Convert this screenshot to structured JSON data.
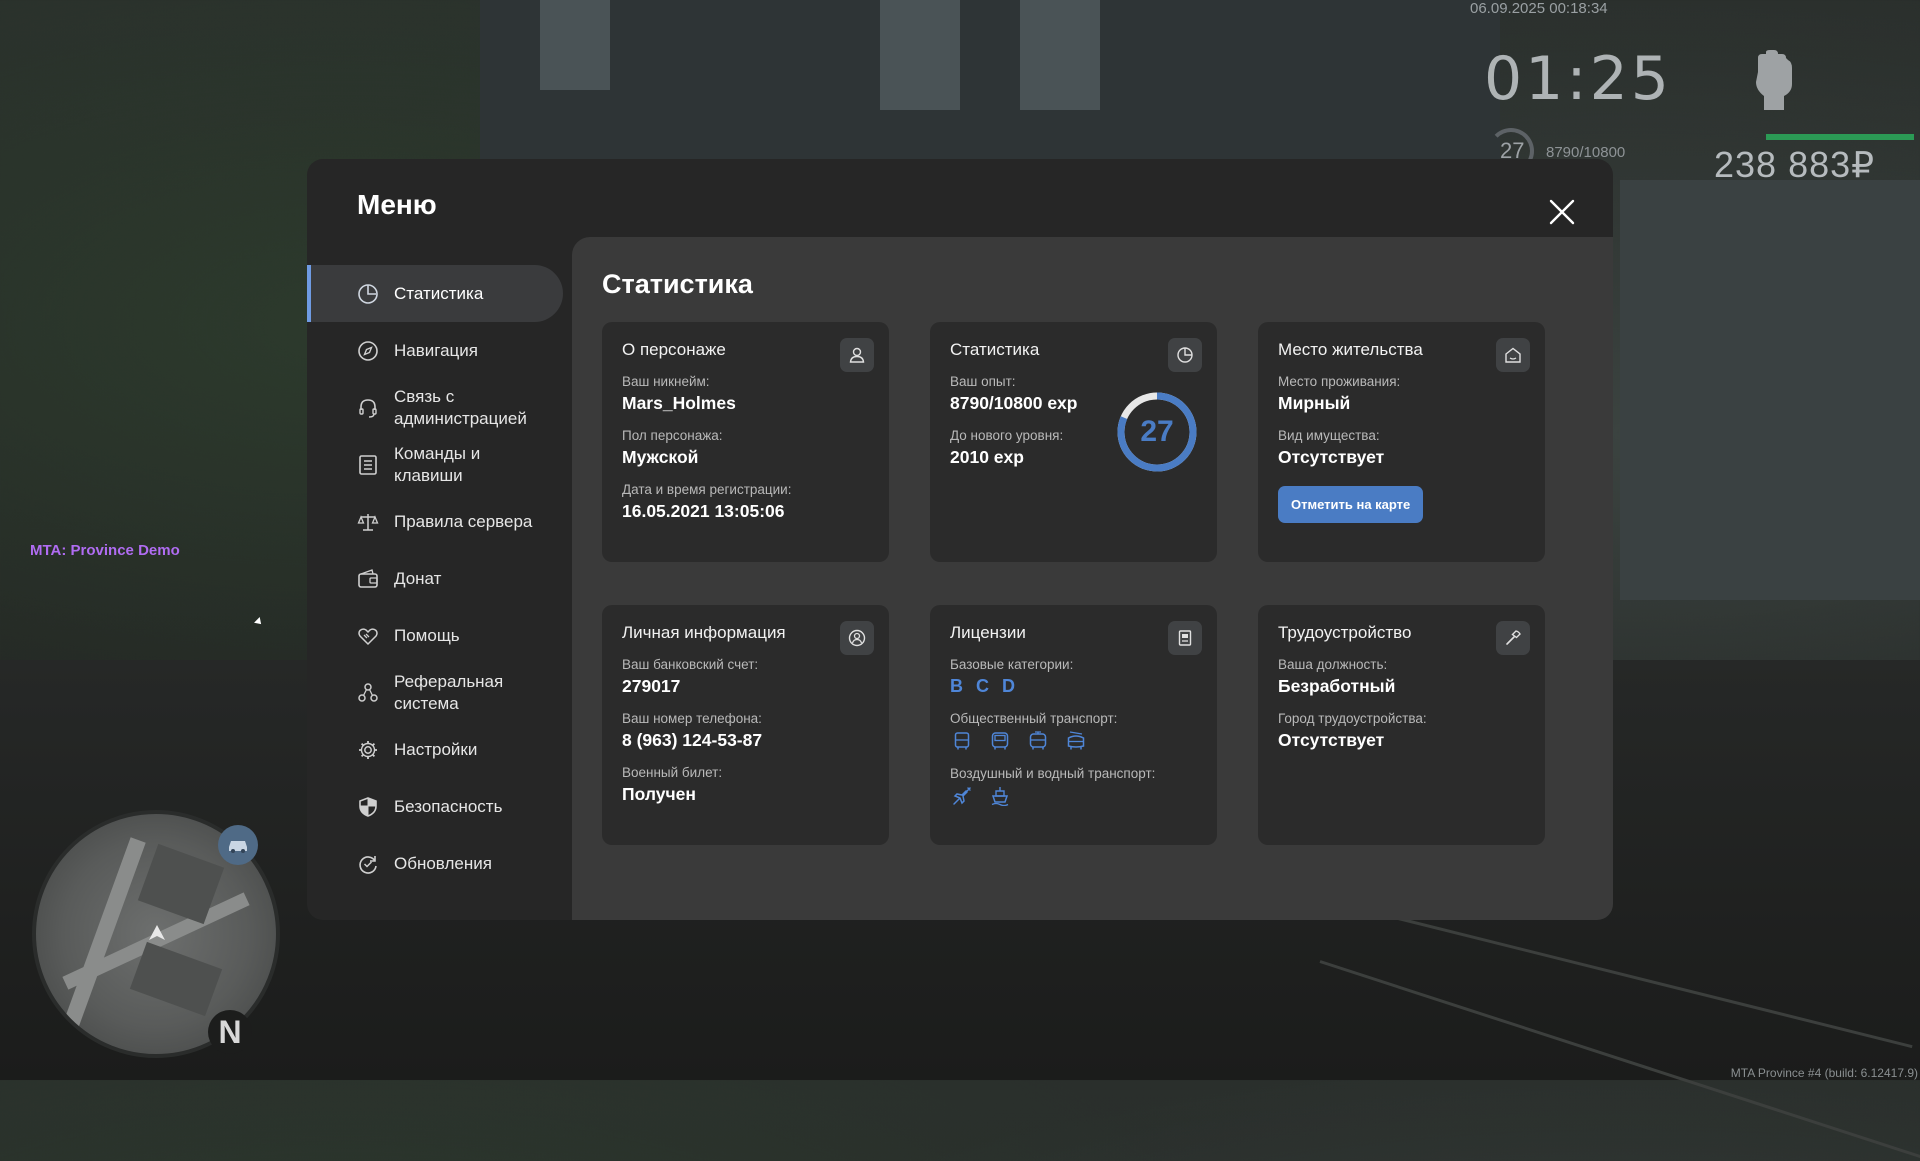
{
  "hud": {
    "datetime": "06.09.2025 00:18:34",
    "clock": "01:25",
    "level": "27",
    "exp": "8790/10800",
    "money": "238 883₽",
    "health_fraction": 1.0
  },
  "server_label": "MTA: Province Demo",
  "build_info": "MTA Province #4 (build: 6.12417.9)",
  "minimap": {
    "north_label": "N"
  },
  "menu": {
    "title": "Меню",
    "sidebar": [
      {
        "label": "Статистика",
        "icon": "pie-chart-icon",
        "active": true
      },
      {
        "label": "Навигация",
        "icon": "compass-icon"
      },
      {
        "label": "Связь с администрацией",
        "icon": "headset-icon"
      },
      {
        "label": "Команды и клавиши",
        "icon": "list-icon"
      },
      {
        "label": "Правила сервера",
        "icon": "scales-icon"
      },
      {
        "label": "Донат",
        "icon": "wallet-icon"
      },
      {
        "label": "Помощь",
        "icon": "handshake-icon"
      },
      {
        "label": "Реферальная система",
        "icon": "referral-icon"
      },
      {
        "label": "Настройки",
        "icon": "gear-icon"
      },
      {
        "label": "Безопасность",
        "icon": "shield-icon"
      },
      {
        "label": "Обновления",
        "icon": "refresh-icon"
      }
    ],
    "content_title": "Статистика",
    "cards": {
      "character": {
        "title": "О персонаже",
        "icon": "user-icon",
        "nickname_label": "Ваш никнейм:",
        "nickname": "Mars_Holmes",
        "gender_label": "Пол персонажа:",
        "gender": "Мужской",
        "reg_label": "Дата и время регистрации:",
        "reg": "16.05.2021 13:05:06"
      },
      "stats": {
        "title": "Статистика",
        "icon": "pie-chart-icon",
        "exp_label": "Ваш опыт:",
        "exp": "8790/10800 exp",
        "next_label": "До нового уровня:",
        "next": "2010 exp",
        "level": "27",
        "progress_fraction": 0.814
      },
      "residence": {
        "title": "Место жительства",
        "icon": "house-icon",
        "place_label": "Место проживания:",
        "place": "Мирный",
        "property_label": "Вид имущества:",
        "property": "Отсутствует",
        "button": "Отметить на карте"
      },
      "personal": {
        "title": "Личная информация",
        "icon": "user-circle-icon",
        "bank_label": "Ваш банковский счет:",
        "bank": "279017",
        "phone_label": "Ваш номер телефона:",
        "phone": "8 (963) 124-53-87",
        "military_label": "Военный билет:",
        "military": "Получен"
      },
      "licenses": {
        "title": "Лицензии",
        "icon": "document-icon",
        "base_label": "Базовые категории:",
        "base": [
          "B",
          "C",
          "D"
        ],
        "public_label": "Общественный транспорт:",
        "public_icons": [
          "bus-icon",
          "bus-front-icon",
          "tram-icon",
          "trolleybus-icon"
        ],
        "air_label": "Воздушный и водный транспорт:",
        "air_icons": [
          "plane-icon",
          "boat-icon"
        ]
      },
      "employment": {
        "title": "Трудоустройство",
        "icon": "hammer-icon",
        "position_label": "Ваша должность:",
        "position": "Безработный",
        "city_label": "Город трудоустройства:",
        "city": "Отсутствует"
      }
    }
  }
}
